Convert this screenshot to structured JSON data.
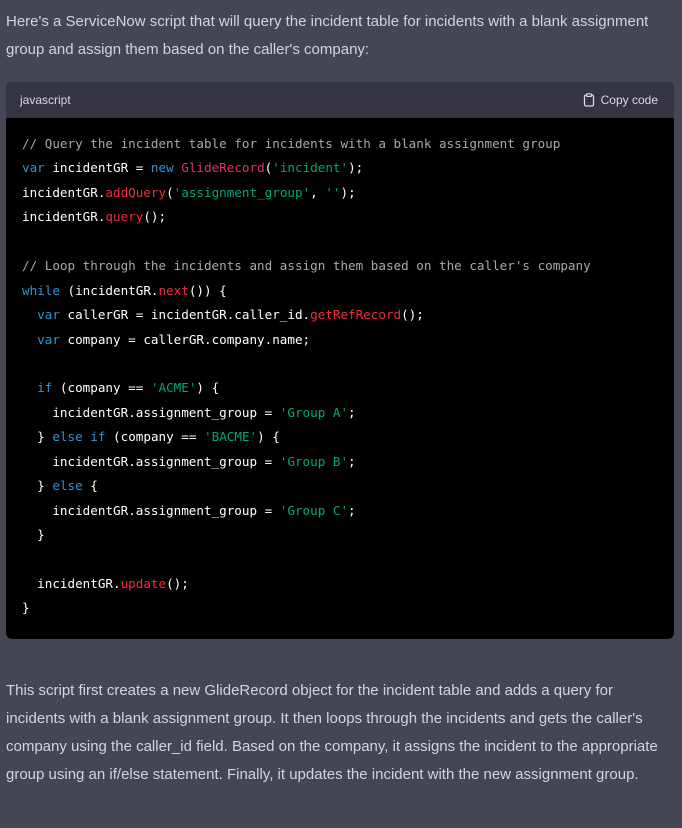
{
  "message": {
    "intro": "Here's a ServiceNow script that will query the incident table for incidents with a blank assignment group and assign them based on the caller's company:",
    "outro": "This script first creates a new GlideRecord object for the incident table and adds a query for incidents with a blank assignment group. It then loops through the incidents and gets the caller's company using the caller_id field. Based on the company, it assigns the incident to the appropriate group using an if/else statement. Finally, it updates the incident with the new assignment group."
  },
  "code_block": {
    "language": "javascript",
    "copy_label": "Copy code",
    "copy_icon": "clipboard-icon",
    "colors": {
      "comment": "#a9a9a9",
      "keyword": "#2e95d3",
      "class": "#df3079",
      "function": "#f22c3d",
      "string": "#00a67d",
      "text": "#ffffff",
      "background": "#000000",
      "header": "#343541"
    },
    "lines": [
      [
        [
          "cm",
          "// Query the incident table for incidents with a blank assignment group"
        ]
      ],
      [
        [
          "kw",
          "var"
        ],
        [
          "plain",
          " incidentGR = "
        ],
        [
          "kw",
          "new"
        ],
        [
          "plain",
          " "
        ],
        [
          "cls",
          "GlideRecord"
        ],
        [
          "plain",
          "("
        ],
        [
          "str",
          "'incident'"
        ],
        [
          "plain",
          ");"
        ]
      ],
      [
        [
          "plain",
          "incidentGR."
        ],
        [
          "fn",
          "addQuery"
        ],
        [
          "plain",
          "("
        ],
        [
          "str",
          "'assignment_group'"
        ],
        [
          "plain",
          ", "
        ],
        [
          "str",
          "''"
        ],
        [
          "plain",
          ");"
        ]
      ],
      [
        [
          "plain",
          "incidentGR."
        ],
        [
          "fn",
          "query"
        ],
        [
          "plain",
          "();"
        ]
      ],
      [],
      [
        [
          "cm",
          "// Loop through the incidents and assign them based on the caller's company"
        ]
      ],
      [
        [
          "kw",
          "while"
        ],
        [
          "plain",
          " (incidentGR."
        ],
        [
          "fn",
          "next"
        ],
        [
          "plain",
          "()) {"
        ]
      ],
      [
        [
          "plain",
          "  "
        ],
        [
          "kw",
          "var"
        ],
        [
          "plain",
          " callerGR = incidentGR.caller_id."
        ],
        [
          "fn",
          "getRefRecord"
        ],
        [
          "plain",
          "();"
        ]
      ],
      [
        [
          "plain",
          "  "
        ],
        [
          "kw",
          "var"
        ],
        [
          "plain",
          " company = callerGR.company.name;"
        ]
      ],
      [],
      [
        [
          "plain",
          "  "
        ],
        [
          "kw",
          "if"
        ],
        [
          "plain",
          " (company == "
        ],
        [
          "str",
          "'ACME'"
        ],
        [
          "plain",
          ") {"
        ]
      ],
      [
        [
          "plain",
          "    incidentGR.assignment_group = "
        ],
        [
          "str",
          "'Group A'"
        ],
        [
          "plain",
          ";"
        ]
      ],
      [
        [
          "plain",
          "  } "
        ],
        [
          "kw",
          "else"
        ],
        [
          "plain",
          " "
        ],
        [
          "kw",
          "if"
        ],
        [
          "plain",
          " (company == "
        ],
        [
          "str",
          "'BACME'"
        ],
        [
          "plain",
          ") {"
        ]
      ],
      [
        [
          "plain",
          "    incidentGR.assignment_group = "
        ],
        [
          "str",
          "'Group B'"
        ],
        [
          "plain",
          ";"
        ]
      ],
      [
        [
          "plain",
          "  } "
        ],
        [
          "kw",
          "else"
        ],
        [
          "plain",
          " {"
        ]
      ],
      [
        [
          "plain",
          "    incidentGR.assignment_group = "
        ],
        [
          "str",
          "'Group C'"
        ],
        [
          "plain",
          ";"
        ]
      ],
      [
        [
          "plain",
          "  }"
        ]
      ],
      [],
      [
        [
          "plain",
          "  incidentGR."
        ],
        [
          "fn",
          "update"
        ],
        [
          "plain",
          "();"
        ]
      ],
      [
        [
          "plain",
          "}"
        ]
      ]
    ]
  }
}
